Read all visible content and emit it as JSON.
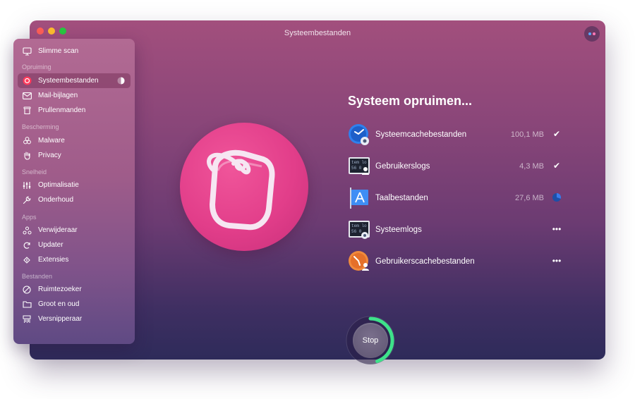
{
  "window": {
    "title": "Systeembestanden"
  },
  "sidebar": {
    "top_item": {
      "label": "Slimme scan",
      "icon": "monitor-icon"
    },
    "sections": [
      {
        "title": "Opruiming",
        "items": [
          {
            "label": "Systeembestanden",
            "icon": "system-junk-icon",
            "active": true
          },
          {
            "label": "Mail-bijlagen",
            "icon": "mail-icon"
          },
          {
            "label": "Prullenmanden",
            "icon": "trash-icon"
          }
        ]
      },
      {
        "title": "Bescherming",
        "items": [
          {
            "label": "Malware",
            "icon": "biohazard-icon"
          },
          {
            "label": "Privacy",
            "icon": "hand-icon"
          }
        ]
      },
      {
        "title": "Snelheid",
        "items": [
          {
            "label": "Optimalisatie",
            "icon": "sliders-icon"
          },
          {
            "label": "Onderhoud",
            "icon": "wrench-icon"
          }
        ]
      },
      {
        "title": "Apps",
        "items": [
          {
            "label": "Verwijderaar",
            "icon": "uninstaller-icon"
          },
          {
            "label": "Updater",
            "icon": "updater-icon"
          },
          {
            "label": "Extensies",
            "icon": "extensions-icon"
          }
        ]
      },
      {
        "title": "Bestanden",
        "items": [
          {
            "label": "Ruimtezoeker",
            "icon": "space-lens-icon"
          },
          {
            "label": "Groot en oud",
            "icon": "folder-icon"
          },
          {
            "label": "Versnipperaar",
            "icon": "shredder-icon"
          }
        ]
      }
    ],
    "active_progress": 0.5
  },
  "main": {
    "heading": "Systeem opruimen...",
    "rows": [
      {
        "name": "Systeemcachebestanden",
        "size": "100,1 MB",
        "status": "done",
        "status_text": "✔",
        "icon": "system-cache-icon"
      },
      {
        "name": "Gebruikerslogs",
        "size": "4,3 MB",
        "status": "done",
        "status_text": "✔",
        "icon": "user-logs-icon"
      },
      {
        "name": "Taalbestanden",
        "size": "27,6 MB",
        "status": "in-progress",
        "status_text": "",
        "icon": "language-files-icon"
      },
      {
        "name": "Systeemlogs",
        "size": "",
        "status": "pending",
        "status_text": "•••",
        "icon": "system-logs-icon"
      },
      {
        "name": "Gebruikerscachebestanden",
        "size": "",
        "status": "pending",
        "status_text": "•••",
        "icon": "user-cache-icon"
      }
    ],
    "stop_label": "Stop",
    "stop_progress": 0.45
  },
  "colors": {
    "accent_green": "#3ee28a",
    "progress_blue": "#3a7bea",
    "hero_pink": "#e23e8a"
  }
}
